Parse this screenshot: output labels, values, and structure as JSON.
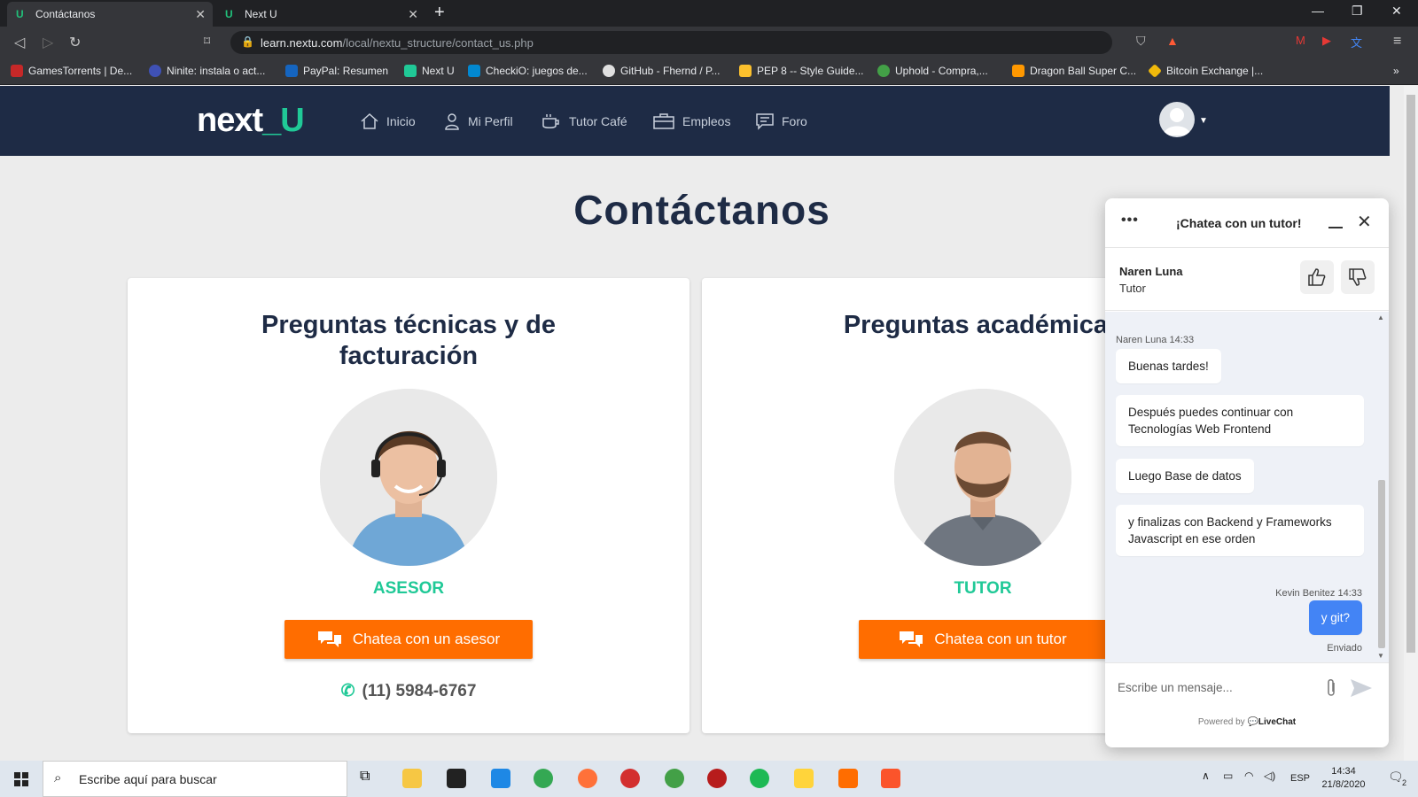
{
  "browser": {
    "tabs": [
      {
        "title": "Contáctanos",
        "active": true
      },
      {
        "title": "Next U",
        "active": false
      }
    ],
    "url_host": "learn.nextu.com",
    "url_path": "/local/nextu_structure/contact_us.php",
    "bookmarks": [
      {
        "label": "GamesTorrents | De...",
        "color": "#c62828"
      },
      {
        "label": "Ninite: instala o act...",
        "color": "#3f51b5"
      },
      {
        "label": "PayPal: Resumen",
        "color": "#1565c0"
      },
      {
        "label": "Next U",
        "color": "#20c997"
      },
      {
        "label": "CheckiO: juegos de...",
        "color": "#0288d1"
      },
      {
        "label": "GitHub - Fhernd / P...",
        "color": "#e0e0e0"
      },
      {
        "label": "PEP 8 -- Style Guide...",
        "color": "#fbc02d"
      },
      {
        "label": "Uphold - Compra,...",
        "color": "#43a047"
      },
      {
        "label": "Dragon Ball Super C...",
        "color": "#ff9800"
      },
      {
        "label": "Bitcoin Exchange |...",
        "color": "#f0b90b"
      }
    ]
  },
  "site": {
    "logo_main": "next",
    "logo_u": "_U",
    "nav": [
      "Inicio",
      "Mi Perfil",
      "Tutor Café",
      "Empleos",
      "Foro"
    ],
    "page_title": "Contáctanos",
    "cards": [
      {
        "heading": "Preguntas técnicas y de facturación",
        "role": "ASESOR",
        "button": "Chatea con un asesor",
        "phone": "(11) 5984-6767"
      },
      {
        "heading": "Preguntas académicas",
        "role": "TUTOR",
        "button": "Chatea con un tutor"
      }
    ]
  },
  "livechat": {
    "title": "¡Chatea con un tutor!",
    "agent_name": "Naren Luna",
    "agent_role": "Tutor",
    "agent_meta": "Naren Luna 14:33",
    "messages": [
      "Buenas tardes!",
      "Después puedes continuar con Tecnologías Web Frontend",
      "Luego Base de datos",
      "y finalizas con Backend y Frameworks Javascript en ese orden"
    ],
    "user_meta": "Kevin Benitez 14:33",
    "user_message": "y git?",
    "status": "Enviado",
    "input_placeholder": "Escribe un mensaje...",
    "powered_by": "Powered by",
    "brand": "LiveChat"
  },
  "taskbar": {
    "search_placeholder": "Escribe aquí para buscar",
    "lang": "ESP",
    "time": "14:34",
    "date": "21/8/2020",
    "notifications": "2"
  },
  "colors": {
    "brand_navy": "#1e2b45",
    "accent_green": "#20c997",
    "cta_orange": "#ff6d00",
    "chat_blue": "#4384f5"
  }
}
